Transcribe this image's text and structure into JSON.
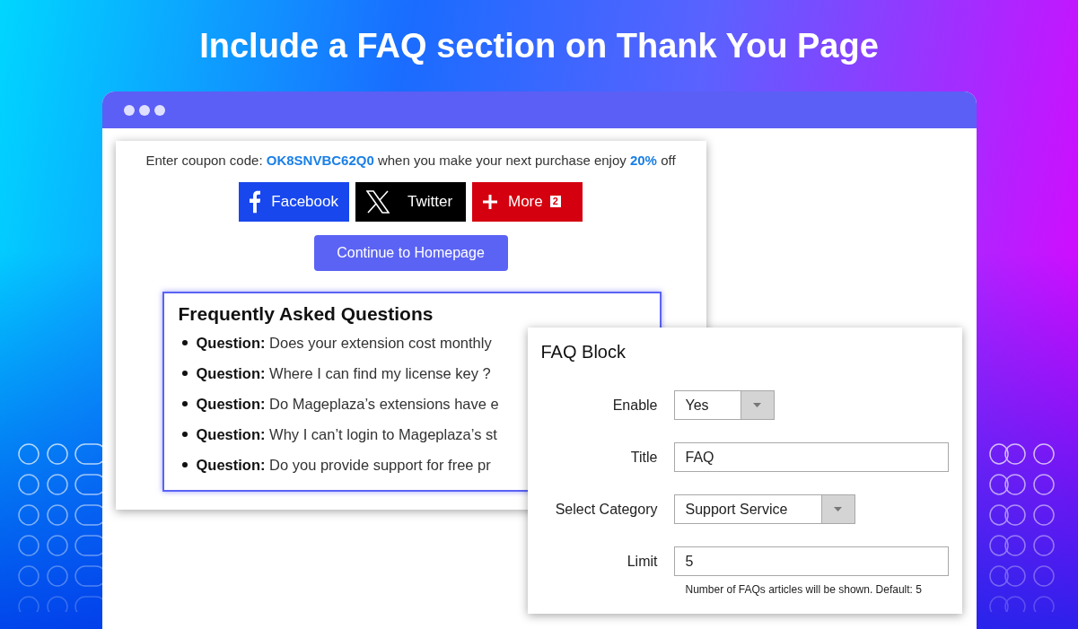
{
  "headline": "Include a FAQ section on Thank You Page",
  "coupon": {
    "before": "Enter coupon code:",
    "code": "OK8SNVBC62Q0",
    "middle": "when you make your next purchase enjoy",
    "discount": "20%",
    "after": "off"
  },
  "share_buttons": [
    {
      "kind": "facebook",
      "label": "Facebook"
    },
    {
      "kind": "twitter",
      "label": "Twitter"
    },
    {
      "kind": "more",
      "label": "More",
      "count": "2"
    }
  ],
  "continue_button": "Continue to Homepage",
  "faq": {
    "heading": "Frequently Asked Questions",
    "questions": [
      "**Question:** Does your extension cost monthly",
      "**Question:** Where I can find my license key ?",
      "**Question:** Do Mageplaza’s extensions have e",
      "**Question:** Why I can’t login to Mageplaza’s st",
      "**Question:** Do you provide support for free pr"
    ]
  },
  "faq_block": {
    "title": "FAQ Block",
    "fields": [
      {
        "kind": "select",
        "label": "Enable",
        "value": "Yes"
      },
      {
        "kind": "text",
        "label": "Title",
        "value": "FAQ"
      },
      {
        "kind": "select",
        "label": "Select Category",
        "value": "Support Service"
      },
      {
        "kind": "text",
        "label": "Limit",
        "value": "5",
        "hint": "Number of FAQs articles will be shown. Default: 5"
      }
    ]
  }
}
